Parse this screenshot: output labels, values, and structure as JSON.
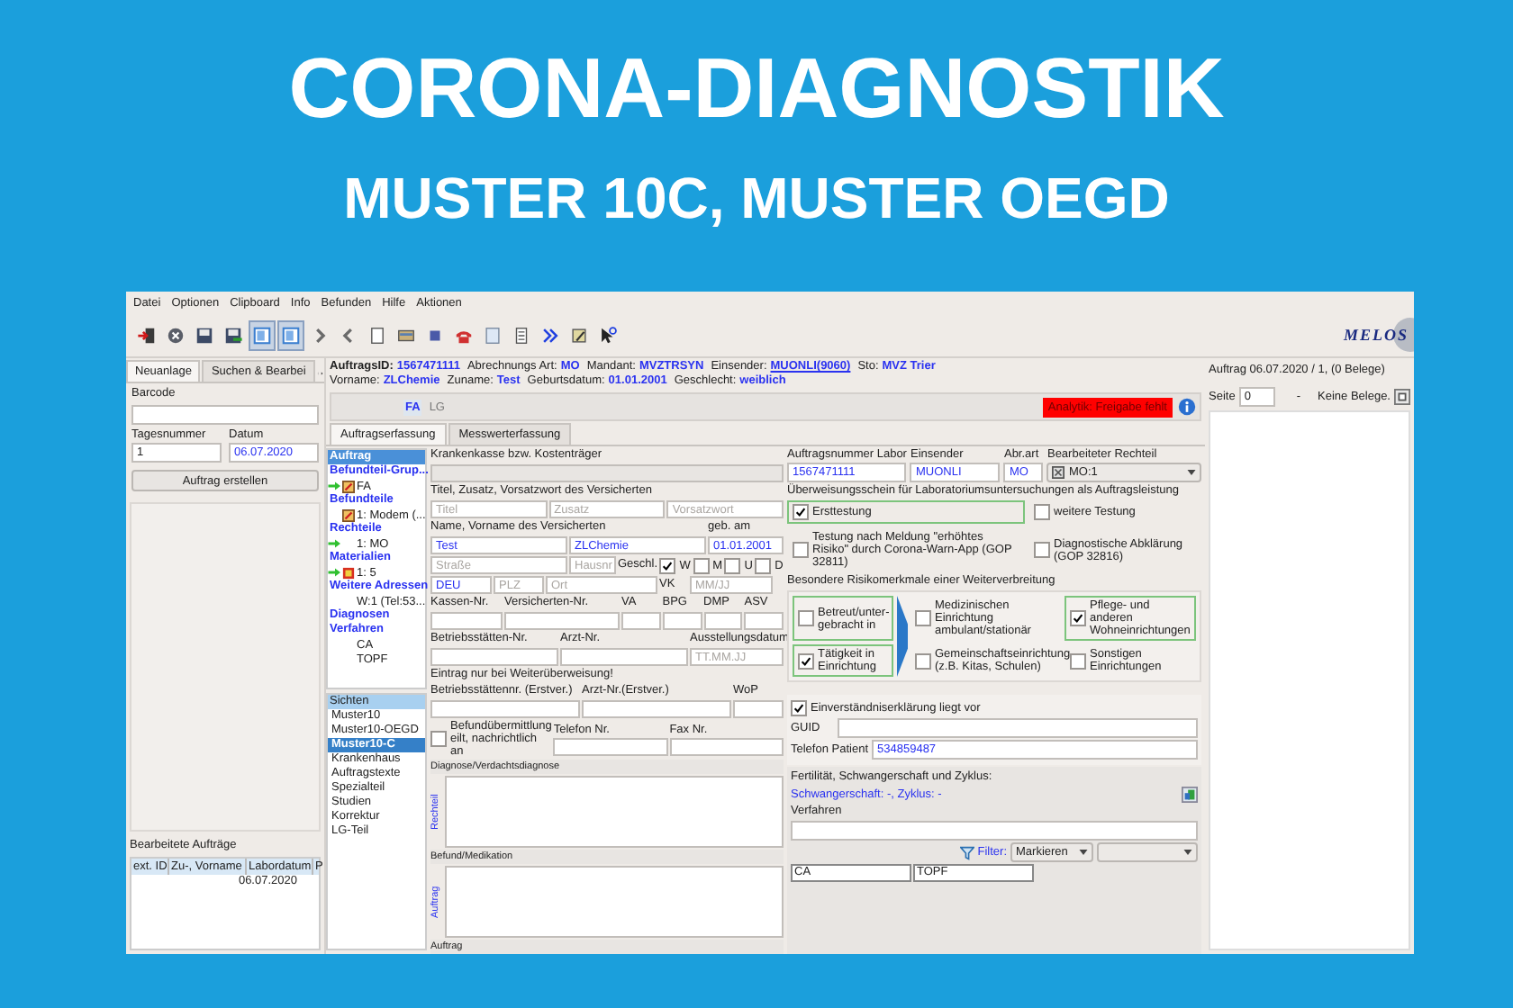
{
  "banner": {
    "title": "CORONA-DIAGNOSTIK",
    "subtitle": "MUSTER 10C, MUSTER OEGD"
  },
  "menu": [
    "Datei",
    "Optionen",
    "Clipboard",
    "Info",
    "Befunden",
    "Hilfe",
    "Aktionen"
  ],
  "toolbar": [
    {
      "kind": "exit",
      "pressed": false
    },
    {
      "kind": "close",
      "pressed": false
    },
    {
      "kind": "save",
      "pressed": false
    },
    {
      "kind": "save-green",
      "pressed": false
    },
    {
      "kind": "window",
      "pressed": true
    },
    {
      "kind": "window",
      "pressed": true
    },
    {
      "kind": "next",
      "pressed": false
    },
    {
      "kind": "back",
      "pressed": false
    },
    {
      "kind": "page",
      "pressed": false
    },
    {
      "kind": "card",
      "pressed": false
    },
    {
      "kind": "square",
      "pressed": false
    },
    {
      "kind": "phone",
      "pressed": false
    },
    {
      "kind": "doc",
      "pressed": false
    },
    {
      "kind": "list",
      "pressed": false
    },
    {
      "kind": "forward",
      "pressed": false
    },
    {
      "kind": "edit",
      "pressed": false
    },
    {
      "kind": "help",
      "pressed": false
    }
  ],
  "logo": "MELOS",
  "left": {
    "tabs": [
      {
        "label": "Neuanlage",
        "selected": true
      },
      {
        "label": "Suchen & Bearbei",
        "selected": false
      }
    ],
    "barcode_label": "Barcode",
    "day_label": "Tagesnummer",
    "day_value": "1",
    "date_label": "Datum",
    "date_value": "06.07.2020",
    "create_button": "Auftrag erstellen",
    "processed_title": "Bearbeitete Aufträge",
    "processed_columns": [
      "ext. ID",
      "Zu-, Vorname",
      "Labordatum",
      "P"
    ],
    "processed_rows": [
      {
        "labordatum": "06.07.2020"
      }
    ]
  },
  "header": [
    [
      {
        "label": "AuftragsID:",
        "value": "1567471111",
        "link": false
      },
      {
        "label": "Abrechnungs Art:",
        "value": "MO",
        "link": false
      },
      {
        "label": "Mandant:",
        "value": "MVZTRSYN",
        "link": false
      },
      {
        "label": "Einsender:",
        "value": "MUONLI(9060)",
        "link": true
      },
      {
        "label": "Sto:",
        "value": "MVZ Trier",
        "link": false
      }
    ],
    [
      {
        "label": "Vorname:",
        "value": "ZLChemie",
        "link": false
      },
      {
        "label": "Zuname:",
        "value": "Test",
        "link": false
      },
      {
        "label": "Geburtsdatum:",
        "value": "01.01.2001",
        "link": false
      },
      {
        "label": "Geschlecht:",
        "value": "weiblich",
        "link": false
      }
    ]
  ],
  "strip": [
    {
      "label": "FA",
      "selected": true
    },
    {
      "label": "LG",
      "selected": false
    }
  ],
  "alert": "Analytik: Freigabe fehlt",
  "tabs": [
    {
      "label": "Auftragserfassung",
      "selected": true
    },
    {
      "label": "Messwerterfassung",
      "selected": false
    }
  ],
  "tree": [
    {
      "label": "Auftrag",
      "selected": true
    },
    {
      "label": "Befundteil-Grup...",
      "selected": false,
      "children": [
        {
          "label": "FA",
          "arrow": true,
          "kind": "report"
        }
      ]
    },
    {
      "label": "Befundteile",
      "selected": false,
      "children": [
        {
          "label": "1: Modem (...",
          "arrow": false,
          "kind": "report"
        }
      ]
    },
    {
      "label": "Rechteile",
      "selected": false,
      "children": [
        {
          "label": "1: MO",
          "arrow": true,
          "kind": "plain"
        }
      ]
    },
    {
      "label": "Materialien",
      "selected": false,
      "children": [
        {
          "label": "1: 5",
          "arrow": true,
          "kind": "rack"
        }
      ]
    },
    {
      "label": "Weitere Adressen",
      "selected": false,
      "children": [
        {
          "label": "W:1 (Tel:53...",
          "arrow": false,
          "kind": "plain"
        }
      ]
    },
    {
      "label": "Diagnosen",
      "selected": false
    },
    {
      "label": "Verfahren",
      "selected": false,
      "children": [
        {
          "label": "CA",
          "arrow": false,
          "kind": "plain"
        },
        {
          "label": "TOPF",
          "arrow": false,
          "kind": "plain"
        }
      ]
    }
  ],
  "views": {
    "title": "Sichten",
    "items": [
      {
        "label": "Muster10",
        "selected": false
      },
      {
        "label": "Muster10-OEGD",
        "selected": false
      },
      {
        "label": "Muster10-C",
        "selected": true
      },
      {
        "label": "Krankenhaus",
        "selected": false
      },
      {
        "label": "Auftragstexte",
        "selected": false
      },
      {
        "label": "Spezialteil",
        "selected": false
      },
      {
        "label": "Studien",
        "selected": false
      },
      {
        "label": "Korrektur",
        "selected": false
      },
      {
        "label": "LG-Teil",
        "selected": false
      }
    ]
  },
  "form_left": {
    "rows": [
      [
        {
          "kind": "label",
          "text": "Krankenkasse bzw. Kostenträger"
        }
      ],
      [
        {
          "kind": "field",
          "disabled": true
        }
      ],
      [
        {
          "kind": "label",
          "text": "Titel, Zusatz, Vorsatzwort des Versicherten"
        }
      ],
      [
        {
          "kind": "field",
          "placeholder": "Titel"
        },
        {
          "kind": "field",
          "placeholder": "Zusatz"
        },
        {
          "kind": "field",
          "placeholder": "Vorsatzwort"
        }
      ],
      [
        {
          "kind": "label",
          "text": "Name, Vorname des Versicherten"
        },
        {
          "kind": "blank"
        },
        {
          "kind": "label",
          "text": "geb. am"
        }
      ],
      [
        {
          "kind": "field",
          "value": "Test"
        },
        {
          "kind": "field",
          "value": "ZLChemie"
        },
        {
          "kind": "field",
          "value": "01.01.2001"
        }
      ],
      [
        {
          "kind": "field",
          "placeholder": "Straße"
        },
        {
          "kind": "field",
          "placeholder": "Hausnr"
        },
        {
          "kind": "label",
          "text": "Geschl."
        },
        {
          "kind": "check",
          "text": "W",
          "checked": true
        },
        {
          "kind": "check",
          "text": "M",
          "checked": false
        },
        {
          "kind": "check",
          "text": "U",
          "checked": false
        },
        {
          "kind": "check",
          "text": "D",
          "checked": false
        }
      ],
      [
        {
          "kind": "field",
          "value": "DEU"
        },
        {
          "kind": "field",
          "placeholder": "PLZ"
        },
        {
          "kind": "field",
          "placeholder": "Ort"
        },
        {
          "kind": "label",
          "text": "VK"
        },
        {
          "kind": "field",
          "placeholder": "MM/JJ"
        }
      ],
      [
        {
          "kind": "label",
          "text": "Kassen-Nr."
        },
        {
          "kind": "label",
          "text": "Versicherten-Nr."
        },
        {
          "kind": "label",
          "text": "VA"
        },
        {
          "kind": "label",
          "text": "BPG"
        },
        {
          "kind": "label",
          "text": "DMP"
        },
        {
          "kind": "label",
          "text": "ASV"
        }
      ],
      [
        {
          "kind": "field"
        },
        {
          "kind": "field"
        },
        {
          "kind": "field"
        },
        {
          "kind": "field"
        },
        {
          "kind": "field"
        },
        {
          "kind": "field"
        }
      ],
      [
        {
          "kind": "label",
          "text": "Betriebsstätten-Nr."
        },
        {
          "kind": "label",
          "text": "Arzt-Nr."
        },
        {
          "kind": "label",
          "text": "Ausstellungsdatum"
        }
      ],
      [
        {
          "kind": "field"
        },
        {
          "kind": "field"
        },
        {
          "kind": "field",
          "placeholder": "TT.MM.JJ"
        }
      ],
      [
        {
          "kind": "label",
          "text": "Eintrag nur bei Weiterüberweisung!"
        }
      ],
      [
        {
          "kind": "label",
          "text": "Betriebsstättennr. (Erstver.)"
        },
        {
          "kind": "label",
          "text": "Arzt-Nr.(Erstver.)"
        },
        {
          "kind": "label",
          "text": "WoP"
        }
      ],
      [
        {
          "kind": "field"
        },
        {
          "kind": "field"
        },
        {
          "kind": "field"
        }
      ],
      [
        {
          "kind": "check",
          "text": "Befundübermittlung eilt, nachrichtlich an",
          "checked": false
        },
        {
          "kind": "labeled",
          "text": "Telefon Nr."
        },
        {
          "kind": "labeled",
          "text": "Fax Nr."
        }
      ]
    ],
    "notes": [
      {
        "title": "Diagnose/Verdachtsdiagnose",
        "side": "Rechteil"
      },
      {
        "title": "Befund/Medikation",
        "side": "Auftrag"
      }
    ],
    "footer": "Auftrag"
  },
  "form_right": {
    "columns": [
      {
        "label": "Auftragsnummer Labor",
        "value": "1567471111"
      },
      {
        "label": "Einsender",
        "value": "MUONLI"
      },
      {
        "label": "Abr.art",
        "value": "MO"
      }
    ],
    "rechteil": {
      "label": "Bearbeiteter Rechteil",
      "value": "MO:1"
    },
    "referral_title": "Überweisungsschein für Laboratoriumsuntersuchungen als Auftragsleistung",
    "testing": [
      {
        "label": "Ersttestung",
        "checked": true,
        "highlight": true
      },
      {
        "label": "weitere Testung",
        "checked": false,
        "highlight": false
      },
      {
        "label": "Testung nach Meldung \"erhöhtes Risiko\" durch Corona-Warn-App (GOP 32811)",
        "checked": false,
        "highlight": false
      },
      {
        "label": "Diagnostische Abklärung (GOP 32816)",
        "checked": false,
        "highlight": false
      }
    ],
    "risk_title": "Besondere Risikomerkmale einer Weiterverbreitung",
    "risk": [
      {
        "label": "Betreut/unter-gebracht in",
        "checked": false,
        "highlight": true
      },
      {
        "label": "Medizinischen Einrichtung ambulant/stationär",
        "checked": false,
        "highlight": false
      },
      {
        "label": "Pflege- und anderen Wohneinrichtungen",
        "checked": true,
        "highlight": true
      },
      {
        "label": "Tätigkeit in Einrichtung",
        "checked": true,
        "highlight": true
      },
      {
        "label": "Gemeinschaftseinrichtung (z.B. Kitas, Schulen)",
        "checked": false,
        "highlight": false
      },
      {
        "label": "Sonstigen Einrichtungen",
        "checked": false,
        "highlight": false
      }
    ],
    "consent": {
      "label": "Einverständniserklärung liegt vor",
      "checked": true
    },
    "guid_label": "GUID",
    "phone_label": "Telefon Patient",
    "phone_value": "534859487",
    "fertility_title": "Fertilität, Schwangerschaft und Zyklus:",
    "fertility_value": "Schwangerschaft: -, Zyklus: -",
    "procedures_label": "Verfahren",
    "filter_label": "Filter:",
    "filter_mode": "Markieren",
    "procedure_cells": [
      "CA",
      "TOPF"
    ]
  },
  "right": {
    "title": "Auftrag 06.07.2020 / 1,  (0 Belege)",
    "page_label": "Seite",
    "page_value": "0",
    "dash": "-",
    "empty": "Keine Belege."
  }
}
